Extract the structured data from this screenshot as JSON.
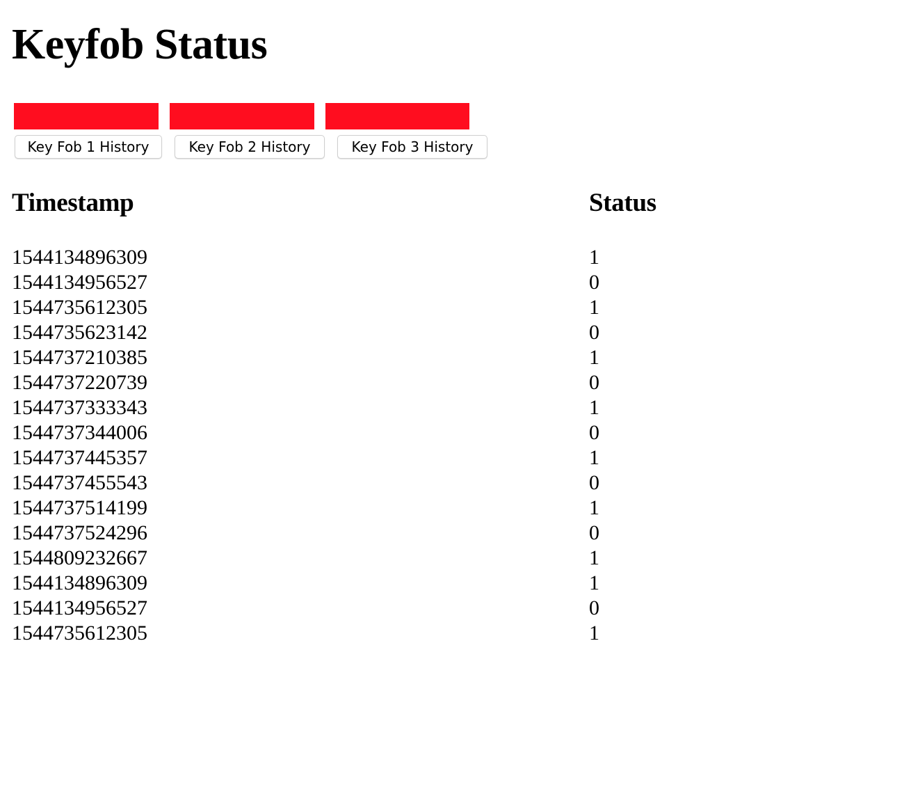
{
  "page": {
    "title": "Keyfob Status"
  },
  "indicators": [
    {
      "name": "Key Fob 1",
      "color": "#ff0d1f"
    },
    {
      "name": "Key Fob 2",
      "color": "#ff0d1f"
    },
    {
      "name": "Key Fob 3",
      "color": "#ff0d1f"
    }
  ],
  "buttons": [
    {
      "label": "Key Fob 1 History"
    },
    {
      "label": "Key Fob 2 History"
    },
    {
      "label": "Key Fob 3 History"
    }
  ],
  "table": {
    "headers": {
      "timestamp": "Timestamp",
      "status": "Status"
    },
    "rows": [
      {
        "timestamp": "1544134896309",
        "status": "1"
      },
      {
        "timestamp": "1544134956527",
        "status": "0"
      },
      {
        "timestamp": "1544735612305",
        "status": "1"
      },
      {
        "timestamp": "1544735623142",
        "status": "0"
      },
      {
        "timestamp": "1544737210385",
        "status": "1"
      },
      {
        "timestamp": "1544737220739",
        "status": "0"
      },
      {
        "timestamp": "1544737333343",
        "status": "1"
      },
      {
        "timestamp": "1544737344006",
        "status": "0"
      },
      {
        "timestamp": "1544737445357",
        "status": "1"
      },
      {
        "timestamp": "1544737455543",
        "status": "0"
      },
      {
        "timestamp": "1544737514199",
        "status": "1"
      },
      {
        "timestamp": "1544737524296",
        "status": "0"
      },
      {
        "timestamp": "1544809232667",
        "status": "1"
      },
      {
        "timestamp": "1544134896309",
        "status": "1"
      },
      {
        "timestamp": "1544134956527",
        "status": "0"
      },
      {
        "timestamp": "1544735612305",
        "status": "1"
      }
    ]
  }
}
